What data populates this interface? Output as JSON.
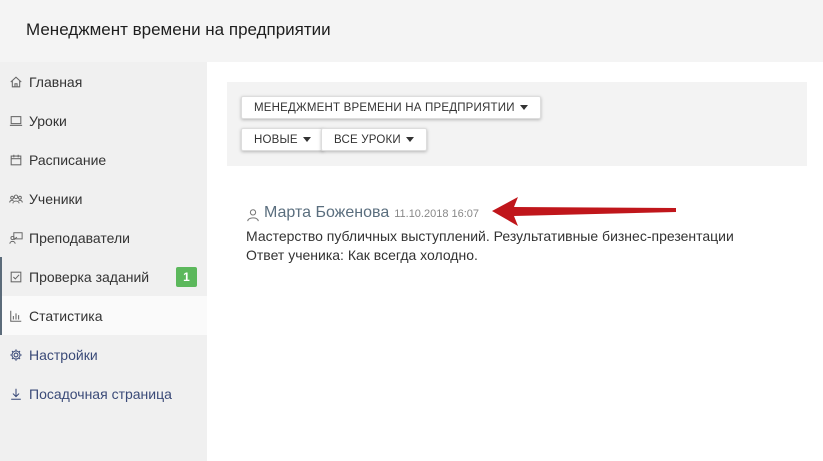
{
  "header": {
    "title": "Менеджмент времени на предприятии"
  },
  "sidebar": {
    "items": [
      {
        "label": "Главная",
        "icon": "home-icon"
      },
      {
        "label": "Уроки",
        "icon": "laptop-icon"
      },
      {
        "label": "Расписание",
        "icon": "calendar-icon"
      },
      {
        "label": "Ученики",
        "icon": "users-icon"
      },
      {
        "label": "Преподаватели",
        "icon": "teacher-icon"
      },
      {
        "label": "Проверка заданий",
        "icon": "checkbox-icon",
        "badge": "1"
      },
      {
        "label": "Статистика",
        "icon": "bar-chart-icon"
      },
      {
        "label": "Настройки",
        "icon": "gear-icon"
      },
      {
        "label": "Посадочная страница",
        "icon": "download-icon"
      }
    ]
  },
  "filters": {
    "course": "МЕНЕДЖМЕНТ ВРЕМЕНИ НА ПРЕДПРИЯТИИ",
    "status": "НОВЫЕ",
    "lessons": "ВСЕ УРОКИ"
  },
  "result": {
    "author": "Марта Боженова",
    "date": "11.10.2018 16:07",
    "course": "Мастерство публичных выступлений. Результативные бизнес-презентации",
    "answer": "Ответ ученика: Как всегда холодно."
  },
  "colors": {
    "badge": "#5cb85c",
    "arrow": "#c0161b",
    "link": "#3a4a78"
  }
}
